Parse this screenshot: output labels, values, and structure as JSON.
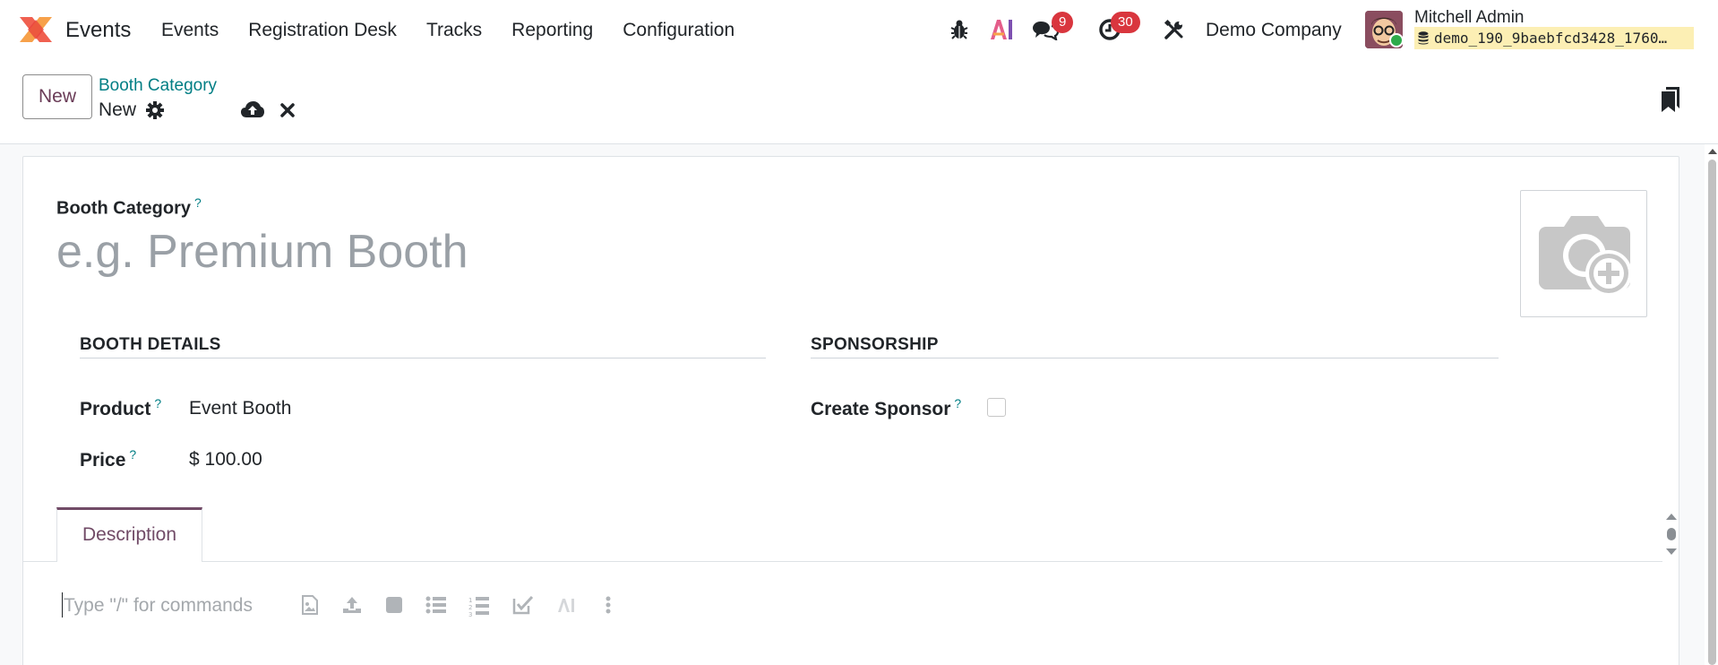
{
  "navbar": {
    "app_name": "Events",
    "menu": [
      "Events",
      "Registration Desk",
      "Tracks",
      "Reporting",
      "Configuration"
    ],
    "messages_badge": "9",
    "activities_badge": "30",
    "company": "Demo Company",
    "user_name": "Mitchell Admin",
    "database": "demo_190_9baebfcd3428_1760…",
    "icons": [
      "bug-icon",
      "ai-icon",
      "chat-icon",
      "clock-icon",
      "tools-icon"
    ]
  },
  "control_panel": {
    "new_label": "New",
    "breadcrumb": "Booth Category",
    "record_name": "New"
  },
  "form": {
    "name_label": "Booth Category",
    "name_placeholder": "e.g. Premium Booth",
    "help_mark": "?",
    "booth_details_title": "BOOTH DETAILS",
    "sponsorship_title": "SPONSORSHIP",
    "product_label": "Product",
    "product_value": "Event Booth",
    "price_label": "Price",
    "price_value": "$ 100.00",
    "create_sponsor_label": "Create Sponsor",
    "create_sponsor_checked": false
  },
  "notebook": {
    "tab_description": "Description",
    "editor_placeholder": "Type \"/\" for commands"
  },
  "colors": {
    "accent": "#714b67",
    "link": "#017e84",
    "badge": "#d9363e"
  }
}
